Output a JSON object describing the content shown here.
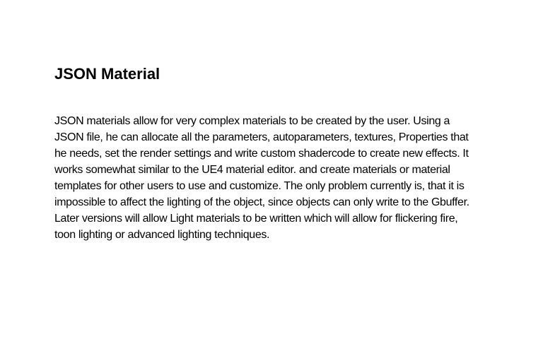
{
  "document": {
    "title": "JSON Material",
    "paragraph_lines": [
      "JSON materials allow for very complex materials to be created by the user. Using a",
      "JSON file, he can allocate all the parameters, autoparameters, textures, Properties that",
      "he needs, set the render settings and write custom shadercode to create new effects. It",
      "works somewhat similar to the UE4 material editor. and create materials or material",
      "templates for other users to use and customize. The only problem currently is, that it is",
      "impossible to affect the lighting of the object, since objects can only write to the Gbuffer.",
      "Later versions will allow Light materials to be written which will allow for flickering fire,",
      "toon lighting or advanced lighting techniques."
    ]
  }
}
